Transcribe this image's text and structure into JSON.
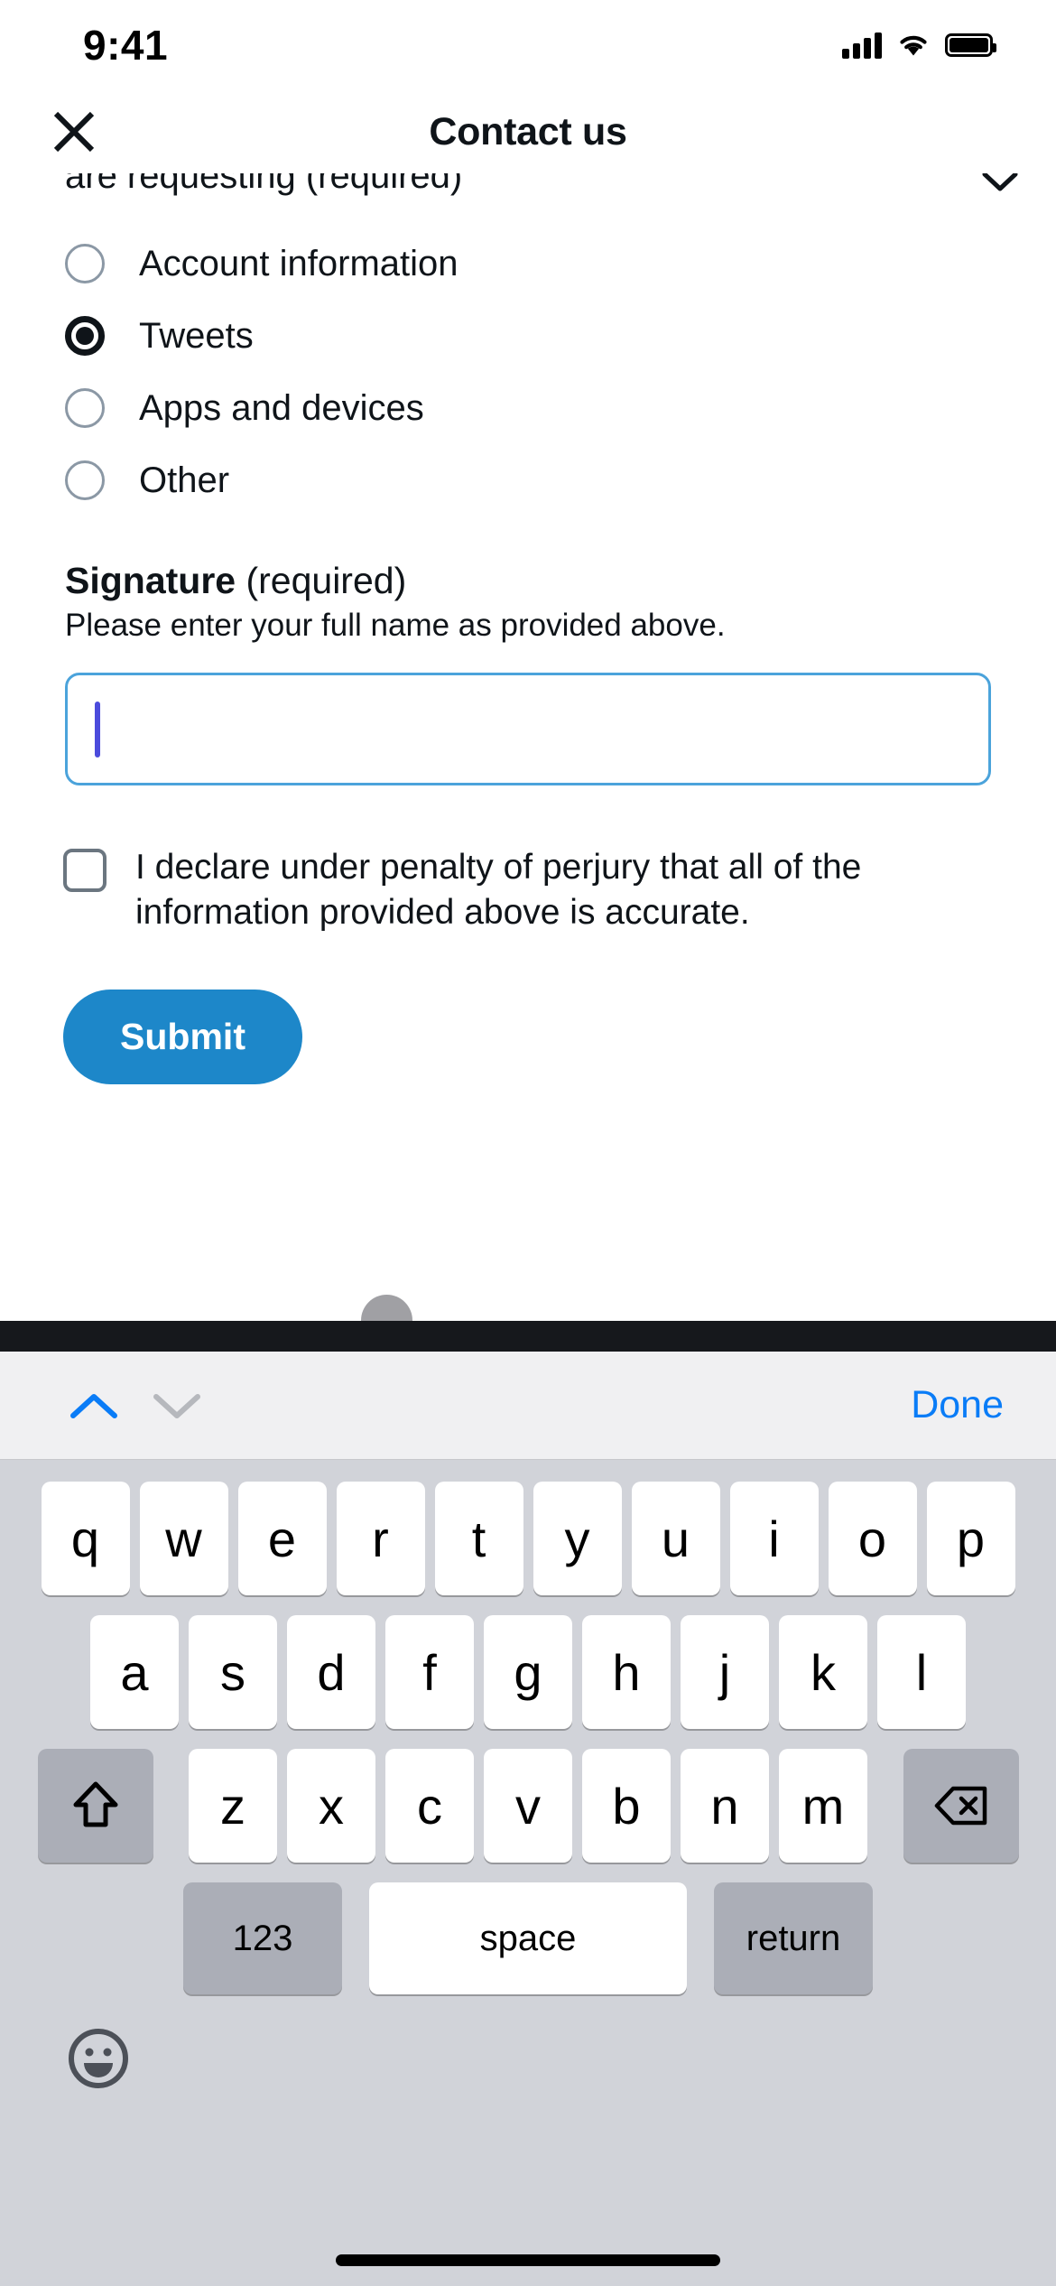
{
  "status_bar": {
    "time": "9:41",
    "cellular_icon": "cellular-bars-icon",
    "wifi_icon": "wifi-icon",
    "battery_icon": "battery-full-icon"
  },
  "header": {
    "title": "Contact us",
    "close_icon": "close-x-icon"
  },
  "form": {
    "truncated_question_label": "are requesting (required)",
    "collapse_icon": "chevron-up-icon",
    "radio_options": [
      {
        "label": "Account information",
        "selected": false
      },
      {
        "label": "Tweets",
        "selected": true
      },
      {
        "label": "Apps and devices",
        "selected": false
      },
      {
        "label": "Other",
        "selected": false
      }
    ],
    "signature": {
      "title_bold": "Signature",
      "title_required": " (required)",
      "hint": "Please enter your full name as provided above.",
      "value": "",
      "placeholder": "",
      "focused": true,
      "border_color": "#4ba3db",
      "caret_color": "#4b4bdc"
    },
    "declaration": {
      "checked": false,
      "text": "I declare under penalty of perjury that all of the information provided above is accurate."
    },
    "submit": {
      "label": "Submit",
      "background_color": "#1d87c9",
      "text_color": "#ffffff"
    }
  },
  "keyboard": {
    "toolbar": {
      "prev_icon": "chevron-up-icon",
      "next_icon": "chevron-down-icon",
      "prev_enabled": true,
      "next_enabled": false,
      "done_label": "Done",
      "done_color": "#0a7cf7"
    },
    "row1": [
      "q",
      "w",
      "e",
      "r",
      "t",
      "y",
      "u",
      "i",
      "o",
      "p"
    ],
    "row2": [
      "a",
      "s",
      "d",
      "f",
      "g",
      "h",
      "j",
      "k",
      "l"
    ],
    "row3": [
      "z",
      "x",
      "c",
      "v",
      "b",
      "n",
      "m"
    ],
    "shift_icon": "shift-arrow-icon",
    "backspace_icon": "backspace-delete-icon",
    "numbers_label": "123",
    "space_label": "space",
    "return_label": "return",
    "emoji_icon": "emoji-smiley-icon"
  },
  "touch_indicator": {
    "visible": true,
    "color": "#a0a0a4"
  }
}
